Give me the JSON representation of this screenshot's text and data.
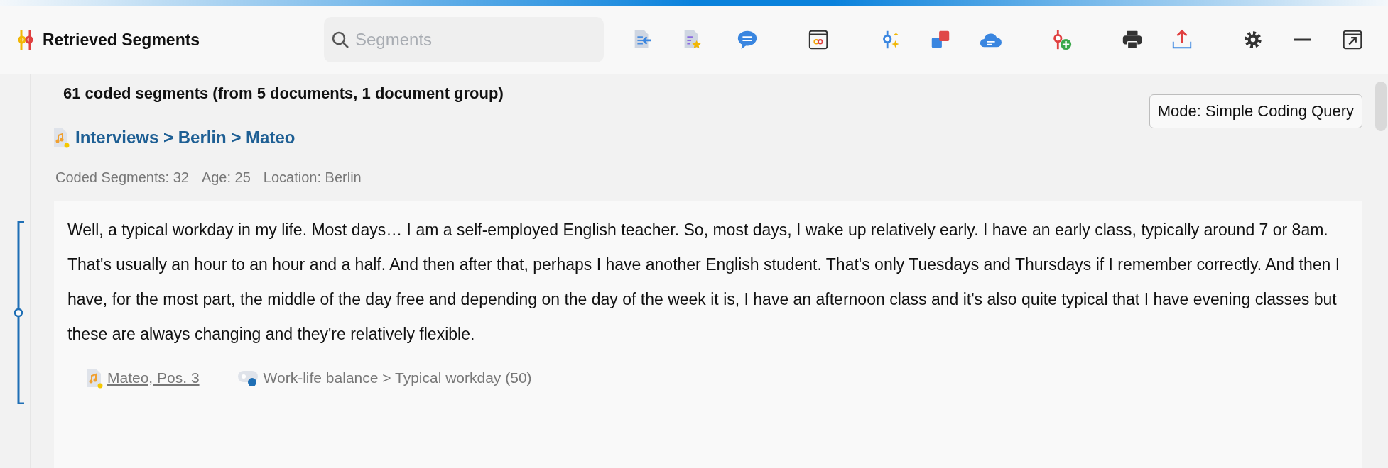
{
  "window": {
    "title": "Retrieved Segments"
  },
  "search": {
    "placeholder": "Segments"
  },
  "summary": "61 coded segments (from 5 documents, 1 document group)",
  "mode_button": "Mode: Simple Coding Query",
  "document": {
    "path": "Interviews > Berlin > Mateo",
    "attributes": [
      "Coded Segments: 32",
      "Age: 25",
      "Location: Berlin"
    ]
  },
  "segment": {
    "text": "Well, a typical workday in my life. Most days… I am a self-employed English teacher. So, most days, I wake up relatively early. I have an early class, typically around 7 or 8am. That's usually an hour to an hour and a half. And then after that, perhaps I have another English student. That's only Tuesdays and Thursdays if I remember correctly. And then I have, for the most part, the middle of the day free and depending on the day of the week it is, I have an afternoon class and it's also quite typical that I have evening classes but these are always changing and they're relatively flexible.",
    "source": "Mateo, Pos. 3",
    "code": {
      "label": "Work-life balance > Typical workday (50)",
      "color": "#1f6fb5"
    }
  }
}
